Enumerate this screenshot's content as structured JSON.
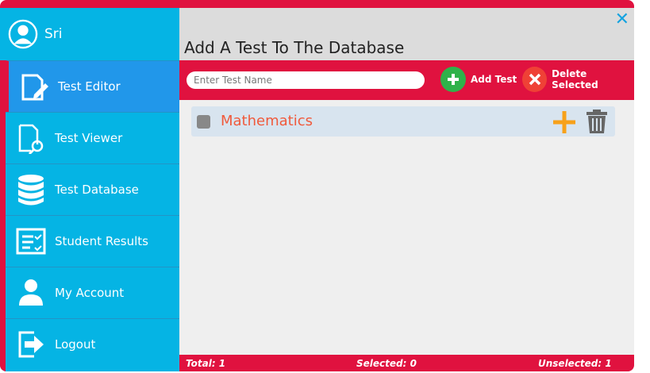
{
  "user": {
    "name": "Sri"
  },
  "nav": [
    {
      "label": "Test Editor",
      "icon": "edit-document-icon"
    },
    {
      "label": "Test Viewer",
      "icon": "document-search-icon"
    },
    {
      "label": "Test Database",
      "icon": "database-icon"
    },
    {
      "label": "Student Results",
      "icon": "checklist-icon"
    },
    {
      "label": "My Account",
      "icon": "user-icon"
    },
    {
      "label": "Logout",
      "icon": "logout-icon"
    }
  ],
  "page": {
    "title": "Add A Test To The Database"
  },
  "toolbar": {
    "search_placeholder": "Enter Test Name",
    "add_label": "Add Test",
    "delete_label": "Delete Selected"
  },
  "tests": [
    {
      "name": "Mathematics"
    }
  ],
  "footer": {
    "total": "Total: 1",
    "selected": "Selected: 0",
    "unselected": "Unselected: 1"
  },
  "colors": {
    "accent": "#e0123f",
    "sidebar": "#05b4e4",
    "active": "#2197ea"
  }
}
